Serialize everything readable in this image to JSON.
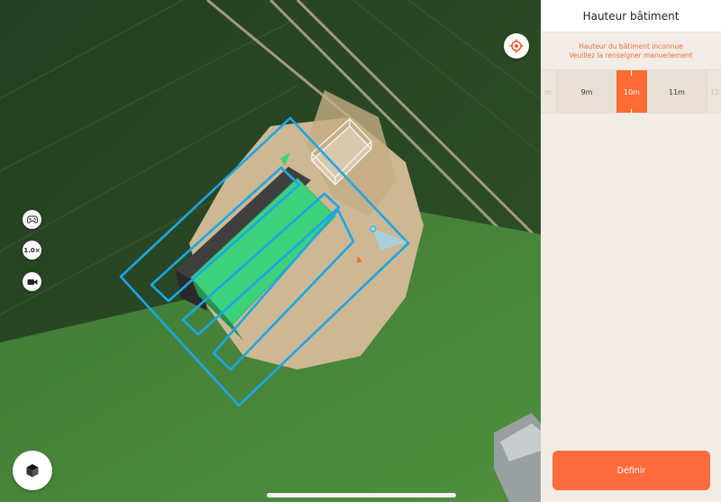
{
  "map": {
    "speed_label": "1.0×",
    "icons": {
      "gamepad": "gamepad-icon",
      "camera": "video-camera-icon",
      "target": "locate-icon",
      "view3d": "cube-icon"
    }
  },
  "panel": {
    "title": "Hauteur bâtiment",
    "warning_line1": "Hauteur du bâtiment inconnue",
    "warning_line2": "Veuillez la renseigner manuellement",
    "height_picker": {
      "left_fragment": "m",
      "options": [
        "9m",
        "10m",
        "11m"
      ],
      "selected": "10m",
      "right_fragment": "12"
    },
    "confirm_label": "Définir"
  },
  "colors": {
    "accent": "#ff6b3d",
    "flight_path": "#1aa7e8",
    "roof_fill": "#3ed17b",
    "panel_bg": "#f1ede6"
  }
}
